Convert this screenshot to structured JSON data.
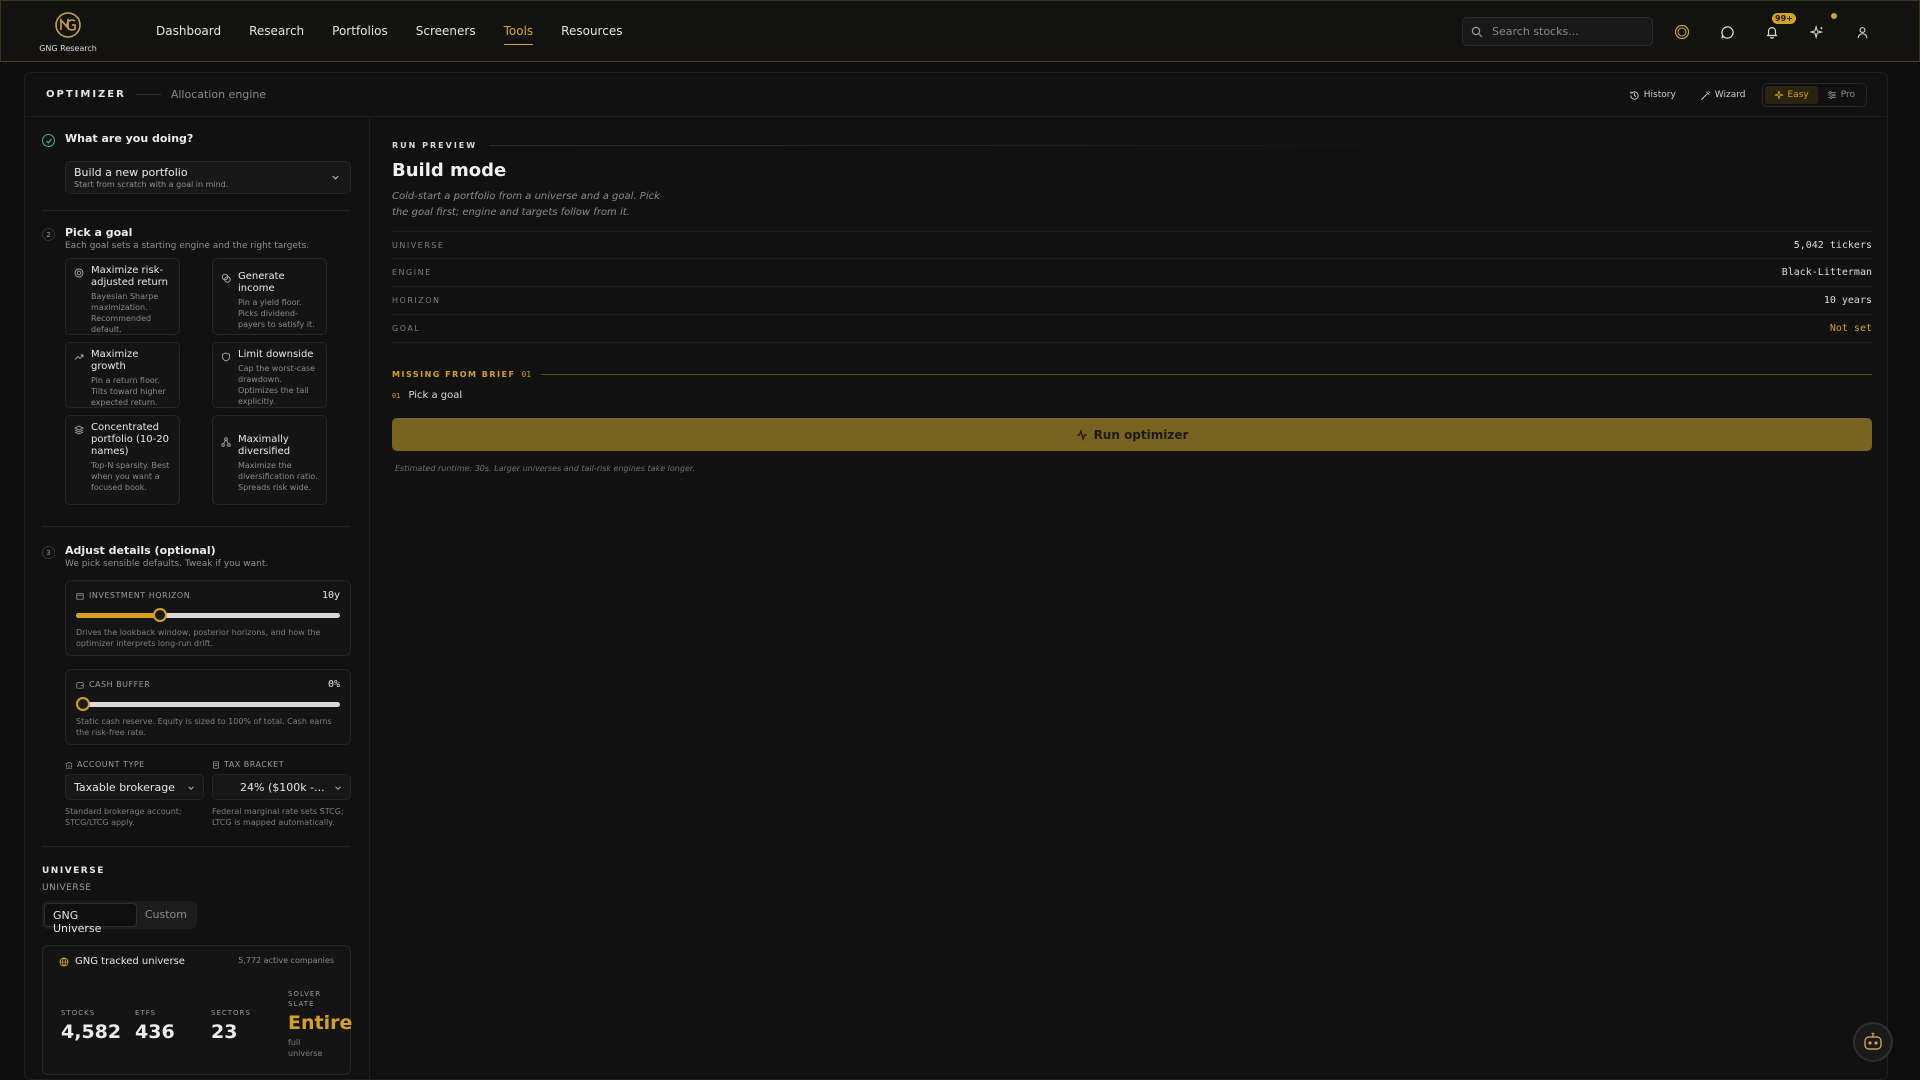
{
  "header": {
    "logo_text": "GNG Research",
    "nav": [
      "Dashboard",
      "Research",
      "Portfolios",
      "Screeners",
      "Tools",
      "Resources"
    ],
    "active_nav": "Tools",
    "search_placeholder": "Search stocks...",
    "notification_badge": "99+",
    "accent": "#d6a21d"
  },
  "panel": {
    "title": "OPTIMIZER",
    "subtitle": "Allocation engine",
    "actions": {
      "history": "History",
      "wizard": "Wizard"
    },
    "modes": {
      "easy": "Easy",
      "pro": "Pro",
      "active": "Easy"
    }
  },
  "step1": {
    "title": "What are you doing?",
    "select_title": "Build a new portfolio",
    "select_desc": "Start from scratch with a goal in mind."
  },
  "step2": {
    "num": "2",
    "title": "Pick a goal",
    "desc": "Each goal sets a starting engine and the right targets.",
    "goals": [
      {
        "icon": "target-icon",
        "title": "Maximize risk-adjusted return",
        "desc": "Bayesian Sharpe maximization. Recommended default."
      },
      {
        "icon": "coins-icon",
        "title": "Generate income",
        "desc": "Pin a yield floor. Picks dividend-payers to satisfy it."
      },
      {
        "icon": "trending-up-icon",
        "title": "Maximize growth",
        "desc": "Pin a return floor. Tilts toward higher expected return."
      },
      {
        "icon": "shield-icon",
        "title": "Limit downside",
        "desc": "Cap the worst-case drawdown. Optimizes the tail explicitly."
      },
      {
        "icon": "layers-icon",
        "title": "Concentrated portfolio (10-20 names)",
        "desc": "Top-N sparsity. Best when you want a focused book."
      },
      {
        "icon": "network-icon",
        "title": "Maximally diversified",
        "desc": "Maximize the diversification ratio. Spreads risk wide."
      }
    ]
  },
  "step3": {
    "num": "3",
    "title": "Adjust details (optional)",
    "desc": "We pick sensible defaults. Tweak if you want.",
    "horizon": {
      "label": "INVESTMENT HORIZON",
      "value": "10y",
      "fraction": 0.32,
      "desc": "Drives the lookback window, posterior horizons, and how the optimizer interprets long-run drift."
    },
    "cash": {
      "label": "CASH BUFFER",
      "value": "0%",
      "fraction": 0.0,
      "desc": "Static cash reserve. Equity is sized to 100% of total. Cash earns the risk-free rate."
    },
    "account": {
      "label": "ACCOUNT TYPE",
      "value": "Taxable brokerage",
      "desc": "Standard brokerage account; STCG/LTCG apply."
    },
    "tax": {
      "label": "TAX BRACKET",
      "value": "24% ($100k -...",
      "desc": "Federal marginal rate sets STCG; LTCG is mapped automatically."
    }
  },
  "universe": {
    "title": "UNIVERSE",
    "sub": "UNIVERSE",
    "tabs": [
      "GNG Universe",
      "Custom"
    ],
    "active_tab": "GNG Universe",
    "card_title": "GNG tracked universe",
    "card_count": "5,772 active companies",
    "stats": [
      {
        "label": "STOCKS",
        "value": "4,582"
      },
      {
        "label": "ETFS",
        "value": "436"
      },
      {
        "label": "SECTORS",
        "value": "23"
      },
      {
        "label": "SOLVER SLATE",
        "value": "Entire",
        "sub": "full universe"
      }
    ]
  },
  "preview": {
    "eyebrow": "RUN PREVIEW",
    "title": "Build mode",
    "desc": "Cold-start a portfolio from a universe and a goal. Pick the goal first; engine and targets follow from it.",
    "rows": [
      {
        "key": "UNIVERSE",
        "value": "5,042 tickers"
      },
      {
        "key": "ENGINE",
        "value": "Black-Litterman"
      },
      {
        "key": "HORIZON",
        "value": "10 years"
      },
      {
        "key": "GOAL",
        "value": "Not set"
      }
    ],
    "missing_title": "MISSING FROM BRIEF",
    "missing_count": "01",
    "missing_items": [
      {
        "num": "01",
        "text": "Pick a goal"
      }
    ],
    "run_label": "Run optimizer",
    "run_note": "Estimated runtime: 30s. Larger universes and tail-risk engines take longer."
  }
}
